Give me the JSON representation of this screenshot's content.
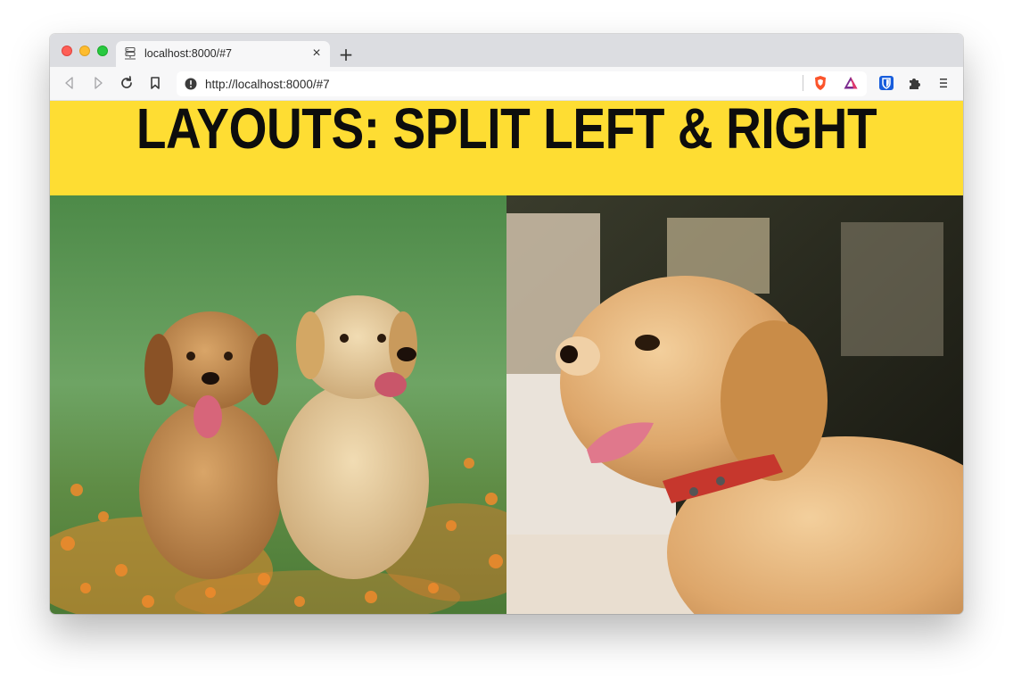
{
  "browser": {
    "tab": {
      "title": "localhost:8000/#7"
    },
    "new_tab_label": "+",
    "close_tab_label": "×",
    "address": {
      "url": "http://localhost:8000/#7"
    }
  },
  "page": {
    "headline": "LAYOUTS: SPLIT LEFT & RIGHT",
    "left_image": "photo-two-puppies-on-grass-with-orange-flowers",
    "right_image": "photo-puppy-lying-down-with-red-collar"
  },
  "colors": {
    "banner": "#fedd33",
    "headline": "#0d0d0d",
    "tabbar": "#dcdde1",
    "toolbar": "#f7f7f8"
  }
}
